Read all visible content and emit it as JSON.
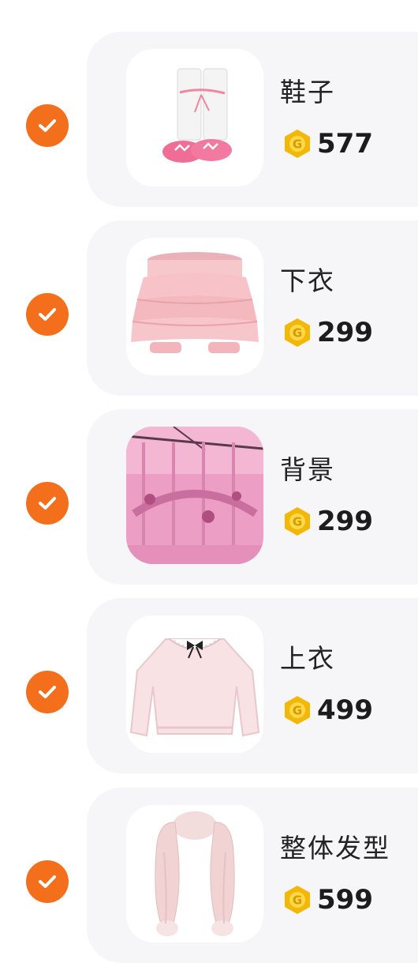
{
  "accent_color": "#f46f1b",
  "card_color": "#f6f6f8",
  "coin_color": "#f2b707",
  "items": [
    {
      "name": "鞋子",
      "price": "577",
      "thumb_icon": "shoes-icon",
      "selected": true
    },
    {
      "name": "下衣",
      "price": "299",
      "thumb_icon": "skirt-icon",
      "selected": true
    },
    {
      "name": "背景",
      "price": "299",
      "thumb_icon": "background-scene-icon",
      "selected": true
    },
    {
      "name": "上衣",
      "price": "499",
      "thumb_icon": "sweater-icon",
      "selected": true
    },
    {
      "name": "整体发型",
      "price": "599",
      "thumb_icon": "hairstyle-icon",
      "selected": true
    }
  ]
}
